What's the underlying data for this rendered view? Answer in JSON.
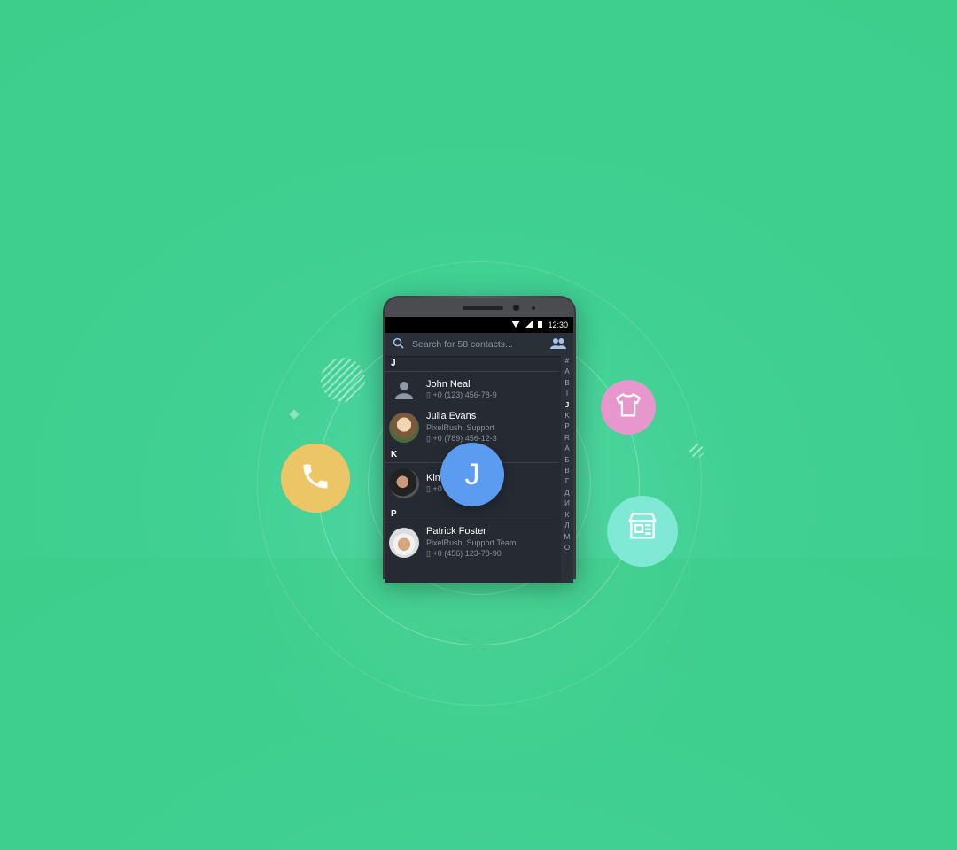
{
  "status_bar": {
    "time": "12:30"
  },
  "search": {
    "placeholder": "Search for 58 contacts..."
  },
  "contacts": {
    "sections": [
      {
        "letter": "J"
      },
      {
        "letter": "K"
      },
      {
        "letter": "P"
      }
    ],
    "items": [
      {
        "name": "John Neal",
        "subtitle": "",
        "phone": "+0 (123) 456-78-9"
      },
      {
        "name": "Julia Evans",
        "subtitle": "PixelRush, Support",
        "phone": "+0 (789) 456-12-3"
      },
      {
        "name": "Kim",
        "subtitle": "",
        "phone": "+0"
      },
      {
        "name": "Patrick Foster",
        "subtitle": "PixelRush, Support Team",
        "phone": "+0 (456) 123-78-90"
      }
    ]
  },
  "alphabet_index": [
    "#",
    "A",
    "B",
    "I",
    "J",
    "K",
    "P",
    "R",
    "А",
    "Б",
    "В",
    "Г",
    "Д",
    "И",
    "К",
    "Л",
    "М",
    "О"
  ],
  "alphabet_selected": "J",
  "popup_letter": "J",
  "colors": {
    "background": "#3dce8c",
    "phone_bubble": "#ecc567",
    "shirt_bubble": "#e897cd",
    "store_bubble": "#7fe9d5",
    "letter_bubble": "#5b9cf0"
  },
  "icons": [
    "phone-icon",
    "shirt-icon",
    "store-icon",
    "search-icon",
    "contacts-group-icon"
  ]
}
